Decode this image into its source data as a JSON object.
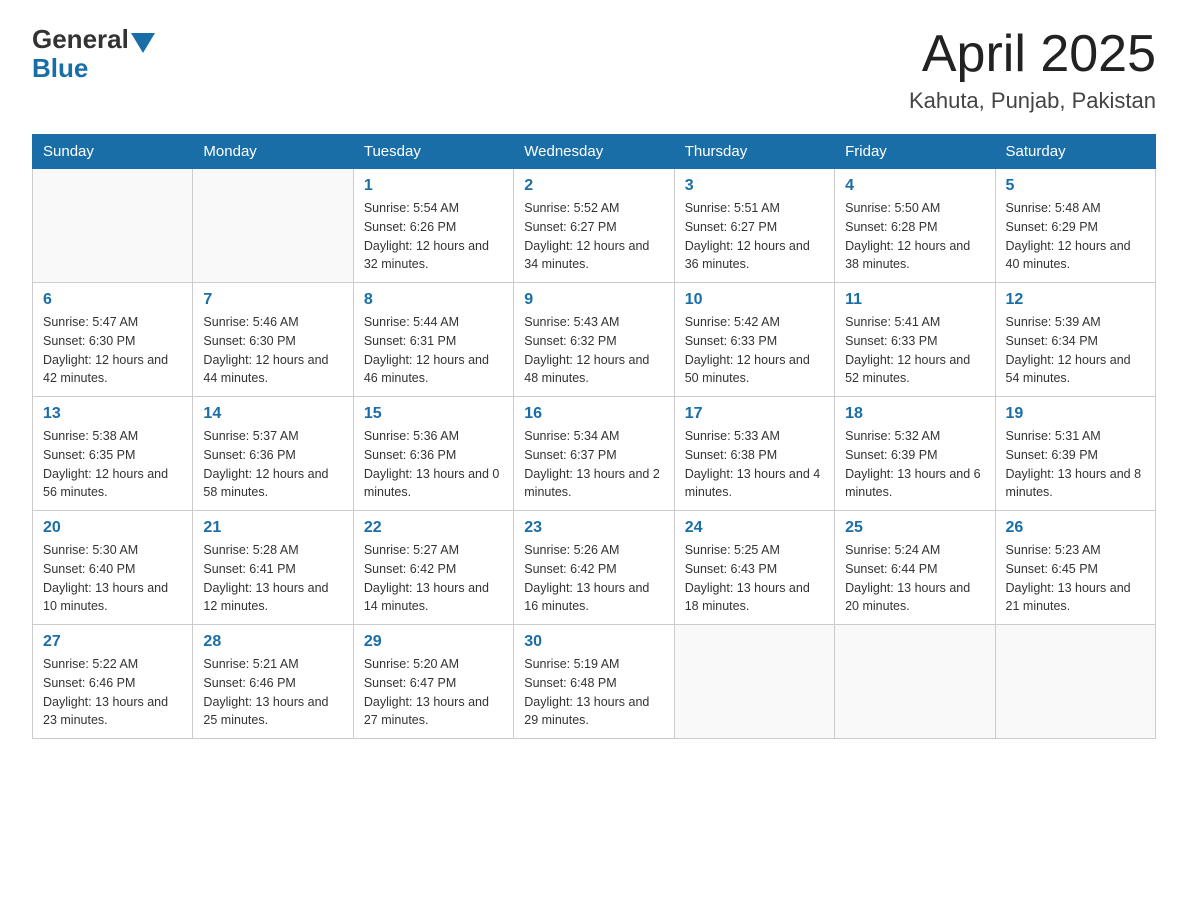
{
  "header": {
    "logo_general": "General",
    "logo_blue": "Blue",
    "month_title": "April 2025",
    "location": "Kahuta, Punjab, Pakistan"
  },
  "days_of_week": [
    "Sunday",
    "Monday",
    "Tuesday",
    "Wednesday",
    "Thursday",
    "Friday",
    "Saturday"
  ],
  "weeks": [
    [
      {
        "day": "",
        "sunrise": "",
        "sunset": "",
        "daylight": ""
      },
      {
        "day": "",
        "sunrise": "",
        "sunset": "",
        "daylight": ""
      },
      {
        "day": "1",
        "sunrise": "Sunrise: 5:54 AM",
        "sunset": "Sunset: 6:26 PM",
        "daylight": "Daylight: 12 hours and 32 minutes."
      },
      {
        "day": "2",
        "sunrise": "Sunrise: 5:52 AM",
        "sunset": "Sunset: 6:27 PM",
        "daylight": "Daylight: 12 hours and 34 minutes."
      },
      {
        "day": "3",
        "sunrise": "Sunrise: 5:51 AM",
        "sunset": "Sunset: 6:27 PM",
        "daylight": "Daylight: 12 hours and 36 minutes."
      },
      {
        "day": "4",
        "sunrise": "Sunrise: 5:50 AM",
        "sunset": "Sunset: 6:28 PM",
        "daylight": "Daylight: 12 hours and 38 minutes."
      },
      {
        "day": "5",
        "sunrise": "Sunrise: 5:48 AM",
        "sunset": "Sunset: 6:29 PM",
        "daylight": "Daylight: 12 hours and 40 minutes."
      }
    ],
    [
      {
        "day": "6",
        "sunrise": "Sunrise: 5:47 AM",
        "sunset": "Sunset: 6:30 PM",
        "daylight": "Daylight: 12 hours and 42 minutes."
      },
      {
        "day": "7",
        "sunrise": "Sunrise: 5:46 AM",
        "sunset": "Sunset: 6:30 PM",
        "daylight": "Daylight: 12 hours and 44 minutes."
      },
      {
        "day": "8",
        "sunrise": "Sunrise: 5:44 AM",
        "sunset": "Sunset: 6:31 PM",
        "daylight": "Daylight: 12 hours and 46 minutes."
      },
      {
        "day": "9",
        "sunrise": "Sunrise: 5:43 AM",
        "sunset": "Sunset: 6:32 PM",
        "daylight": "Daylight: 12 hours and 48 minutes."
      },
      {
        "day": "10",
        "sunrise": "Sunrise: 5:42 AM",
        "sunset": "Sunset: 6:33 PM",
        "daylight": "Daylight: 12 hours and 50 minutes."
      },
      {
        "day": "11",
        "sunrise": "Sunrise: 5:41 AM",
        "sunset": "Sunset: 6:33 PM",
        "daylight": "Daylight: 12 hours and 52 minutes."
      },
      {
        "day": "12",
        "sunrise": "Sunrise: 5:39 AM",
        "sunset": "Sunset: 6:34 PM",
        "daylight": "Daylight: 12 hours and 54 minutes."
      }
    ],
    [
      {
        "day": "13",
        "sunrise": "Sunrise: 5:38 AM",
        "sunset": "Sunset: 6:35 PM",
        "daylight": "Daylight: 12 hours and 56 minutes."
      },
      {
        "day": "14",
        "sunrise": "Sunrise: 5:37 AM",
        "sunset": "Sunset: 6:36 PM",
        "daylight": "Daylight: 12 hours and 58 minutes."
      },
      {
        "day": "15",
        "sunrise": "Sunrise: 5:36 AM",
        "sunset": "Sunset: 6:36 PM",
        "daylight": "Daylight: 13 hours and 0 minutes."
      },
      {
        "day": "16",
        "sunrise": "Sunrise: 5:34 AM",
        "sunset": "Sunset: 6:37 PM",
        "daylight": "Daylight: 13 hours and 2 minutes."
      },
      {
        "day": "17",
        "sunrise": "Sunrise: 5:33 AM",
        "sunset": "Sunset: 6:38 PM",
        "daylight": "Daylight: 13 hours and 4 minutes."
      },
      {
        "day": "18",
        "sunrise": "Sunrise: 5:32 AM",
        "sunset": "Sunset: 6:39 PM",
        "daylight": "Daylight: 13 hours and 6 minutes."
      },
      {
        "day": "19",
        "sunrise": "Sunrise: 5:31 AM",
        "sunset": "Sunset: 6:39 PM",
        "daylight": "Daylight: 13 hours and 8 minutes."
      }
    ],
    [
      {
        "day": "20",
        "sunrise": "Sunrise: 5:30 AM",
        "sunset": "Sunset: 6:40 PM",
        "daylight": "Daylight: 13 hours and 10 minutes."
      },
      {
        "day": "21",
        "sunrise": "Sunrise: 5:28 AM",
        "sunset": "Sunset: 6:41 PM",
        "daylight": "Daylight: 13 hours and 12 minutes."
      },
      {
        "day": "22",
        "sunrise": "Sunrise: 5:27 AM",
        "sunset": "Sunset: 6:42 PM",
        "daylight": "Daylight: 13 hours and 14 minutes."
      },
      {
        "day": "23",
        "sunrise": "Sunrise: 5:26 AM",
        "sunset": "Sunset: 6:42 PM",
        "daylight": "Daylight: 13 hours and 16 minutes."
      },
      {
        "day": "24",
        "sunrise": "Sunrise: 5:25 AM",
        "sunset": "Sunset: 6:43 PM",
        "daylight": "Daylight: 13 hours and 18 minutes."
      },
      {
        "day": "25",
        "sunrise": "Sunrise: 5:24 AM",
        "sunset": "Sunset: 6:44 PM",
        "daylight": "Daylight: 13 hours and 20 minutes."
      },
      {
        "day": "26",
        "sunrise": "Sunrise: 5:23 AM",
        "sunset": "Sunset: 6:45 PM",
        "daylight": "Daylight: 13 hours and 21 minutes."
      }
    ],
    [
      {
        "day": "27",
        "sunrise": "Sunrise: 5:22 AM",
        "sunset": "Sunset: 6:46 PM",
        "daylight": "Daylight: 13 hours and 23 minutes."
      },
      {
        "day": "28",
        "sunrise": "Sunrise: 5:21 AM",
        "sunset": "Sunset: 6:46 PM",
        "daylight": "Daylight: 13 hours and 25 minutes."
      },
      {
        "day": "29",
        "sunrise": "Sunrise: 5:20 AM",
        "sunset": "Sunset: 6:47 PM",
        "daylight": "Daylight: 13 hours and 27 minutes."
      },
      {
        "day": "30",
        "sunrise": "Sunrise: 5:19 AM",
        "sunset": "Sunset: 6:48 PM",
        "daylight": "Daylight: 13 hours and 29 minutes."
      },
      {
        "day": "",
        "sunrise": "",
        "sunset": "",
        "daylight": ""
      },
      {
        "day": "",
        "sunrise": "",
        "sunset": "",
        "daylight": ""
      },
      {
        "day": "",
        "sunrise": "",
        "sunset": "",
        "daylight": ""
      }
    ]
  ]
}
